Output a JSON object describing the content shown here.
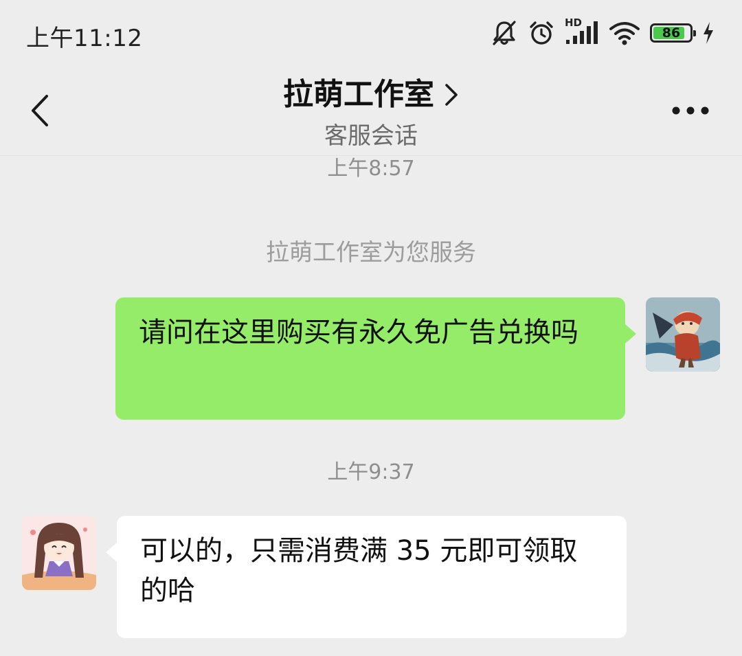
{
  "status_bar": {
    "time": "上午11:12",
    "network_label": "HD",
    "battery_level": "86",
    "battery_fraction": 0.86,
    "icons": [
      "bell-muted-icon",
      "alarm-clock-icon",
      "cellular-signal-icon",
      "wifi-icon",
      "battery-icon",
      "charging-bolt-icon"
    ]
  },
  "header": {
    "title": "拉萌工作室",
    "subtitle": "客服会话",
    "back_icon": "chevron-left-icon",
    "title_arrow_icon": "chevron-right-icon",
    "more_icon": "more-dots-icon"
  },
  "messages": [
    {
      "type": "timestamp",
      "text": "上午8:57"
    },
    {
      "type": "system",
      "text": "拉萌工作室为您服务"
    },
    {
      "type": "outgoing",
      "text": "请问在这里购买有永久免广告兑换吗"
    },
    {
      "type": "timestamp",
      "text": "上午9:37"
    },
    {
      "type": "incoming",
      "text": "可以的，只需消费满 35 元即可领取的哈"
    }
  ],
  "colors": {
    "background": "#ededed",
    "outgoing_bubble": "#95ec69",
    "incoming_bubble": "#ffffff",
    "battery_fill": "#4ac94d"
  }
}
